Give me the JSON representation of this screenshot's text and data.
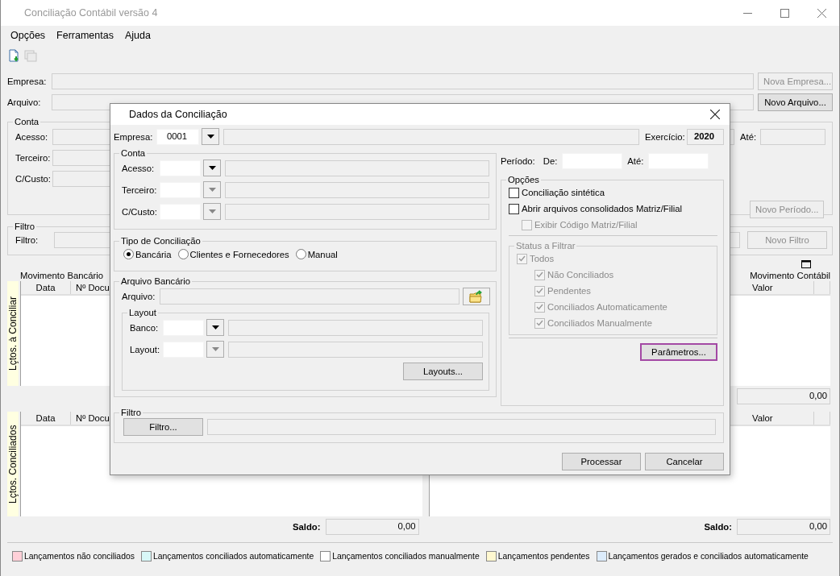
{
  "window": {
    "title": "Conciliação Contábil versão 4"
  },
  "menu": [
    "Opções",
    "Ferramentas",
    "Ajuda"
  ],
  "toolbar": [
    {
      "disabled": false
    },
    {
      "disabled": true
    }
  ],
  "main": {
    "empresa": {
      "label": "Empresa:",
      "button": {
        "label": "Nova Empresa...",
        "disabled": true
      }
    },
    "arquivo": {
      "label": "Arquivo:",
      "button": {
        "label": "Novo Arquivo...",
        "disabled": false
      }
    },
    "conta": {
      "title": "Conta",
      "fields": [
        "Acesso:",
        "Terceiro:",
        "C/Custo:"
      ],
      "ate_label": "Até:",
      "button": {
        "label": "Novo Período...",
        "disabled": true
      }
    },
    "filtro": {
      "title": "Filtro",
      "label": "Filtro:",
      "button": {
        "label": "Novo Filtro",
        "disabled": true
      }
    },
    "grids": [
      {
        "side_label": "Lçtos. à Conciliar",
        "bank_title": "Movimento Bancário",
        "bank_columns": [
          "Data",
          "Nº Docu"
        ],
        "ledger_title": "Movimento Contábil",
        "ledger_columns": [
          "Valor"
        ],
        "ledger_saldo": {
          "value": "0,00"
        }
      },
      {
        "side_label": "Lçtos. Conciliados",
        "bank_columns": [
          "Data",
          "Nº Docu"
        ],
        "ledger_columns": [
          "Valor"
        ],
        "bank_saldo": {
          "label": "Saldo:",
          "value": "0,00"
        },
        "ledger_saldo": {
          "label": "Saldo:",
          "value": "0,00"
        }
      }
    ],
    "legend": [
      {
        "label": "Lançamentos não conciliados",
        "color": "#ffd0d8"
      },
      {
        "label": "Lançamentos conciliados automaticamente",
        "color": "#d8f8f8"
      },
      {
        "label": "Lançamentos conciliados manualmente",
        "color": "#ffffff"
      },
      {
        "label": "Lançamentos pendentes",
        "color": "#fff8d0"
      },
      {
        "label": "Lançamentos gerados e conciliados automaticamente",
        "color": "#dcecfc"
      }
    ]
  },
  "dialog": {
    "title": "Dados da Conciliação",
    "empresa": {
      "label": "Empresa:",
      "value": "0001",
      "disabled": false
    },
    "exercicio": {
      "label": "Exercício:",
      "value": "2020"
    },
    "conta": {
      "title": "Conta",
      "fields": [
        {
          "label": "Acesso:",
          "disabled": false
        },
        {
          "label": "Terceiro:",
          "disabled": true
        },
        {
          "label": "C/Custo:",
          "disabled": true
        }
      ]
    },
    "tipo": {
      "title": "Tipo de Conciliação",
      "options": [
        {
          "label": "Bancária",
          "selected": true
        },
        {
          "label": "Clientes e Fornecedores",
          "selected": false
        },
        {
          "label": "Manual",
          "selected": false
        }
      ]
    },
    "arquivo_bancario": {
      "title": "Arquivo Bancário",
      "label": "Arquivo:",
      "layout": {
        "title": "Layout",
        "fields": [
          {
            "label": "Banco:",
            "disabled": false
          },
          {
            "label": "Layout:",
            "disabled": true
          }
        ],
        "button": "Layouts..."
      }
    },
    "periodo": {
      "label": "Período:",
      "from_label": "De:",
      "to_label": "Até:"
    },
    "opcoes": {
      "title": "Opções",
      "checks": [
        {
          "label": "Conciliação sintética",
          "checked": false,
          "disabled": false
        },
        {
          "label": "Abrir arquivos consolidados Matriz/Filial",
          "checked": false,
          "disabled": false,
          "children": [
            {
              "label": "Exibir Código Matriz/Filial",
              "checked": false,
              "disabled": true
            }
          ]
        }
      ],
      "status": {
        "title": "Status a Filtrar",
        "disabled": true,
        "checks": [
          {
            "label": "Todos",
            "checked": true,
            "disabled": true,
            "children": [
              {
                "label": "Não Conciliados",
                "checked": true,
                "disabled": true
              },
              {
                "label": "Pendentes",
                "checked": true,
                "disabled": true
              },
              {
                "label": "Conciliados Automaticamente",
                "checked": true,
                "disabled": true
              },
              {
                "label": "Conciliados Manualmente",
                "checked": true,
                "disabled": true
              }
            ]
          }
        ]
      },
      "button": {
        "label": "Parâmetros...",
        "highlighted": true
      }
    },
    "filtro": {
      "title": "Filtro",
      "button": "Filtro..."
    },
    "buttons": [
      "Processar",
      "Cancelar"
    ]
  }
}
